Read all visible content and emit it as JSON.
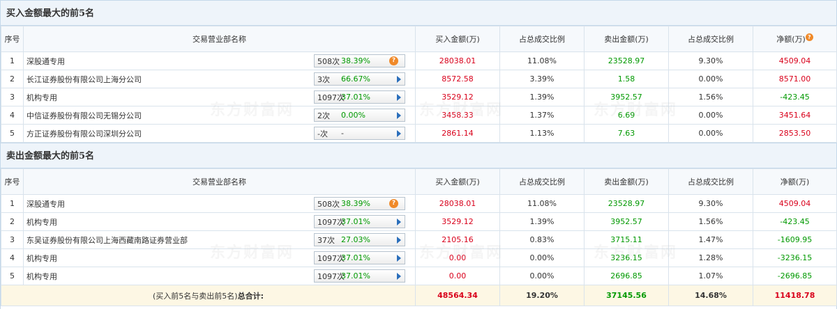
{
  "buy_section": {
    "title": "买入金额最大的前5名",
    "headers": [
      "序号",
      "交易营业部名称",
      "买入金额(万)",
      "占总成交比例",
      "卖出金额(万)",
      "占总成交比例",
      "净额(万)"
    ],
    "rows": [
      {
        "no": "1",
        "name": "深股通专用",
        "cnt": "508次",
        "pct": "38.39%",
        "icon": "question-icon",
        "buy": "28038.01",
        "buy_ratio": "11.08%",
        "sell": "23528.97",
        "sell_ratio": "9.30%",
        "net": "4509.04"
      },
      {
        "no": "2",
        "name": "长江证券股份有限公司上海分公司",
        "cnt": "3次",
        "pct": "66.67%",
        "icon": "arrow-right-icon",
        "buy": "8572.58",
        "buy_ratio": "3.39%",
        "sell": "1.58",
        "sell_ratio": "0.00%",
        "net": "8571.00"
      },
      {
        "no": "3",
        "name": "机构专用",
        "cnt": "1097次",
        "pct": "37.01%",
        "icon": "arrow-right-icon",
        "buy": "3529.12",
        "buy_ratio": "1.39%",
        "sell": "3952.57",
        "sell_ratio": "1.56%",
        "net": "-423.45"
      },
      {
        "no": "4",
        "name": "中信证券股份有限公司无锡分公司",
        "cnt": "2次",
        "pct": "0.00%",
        "icon": "arrow-right-icon",
        "buy": "3458.33",
        "buy_ratio": "1.37%",
        "sell": "6.69",
        "sell_ratio": "0.00%",
        "net": "3451.64"
      },
      {
        "no": "5",
        "name": "方正证券股份有限公司深圳分公司",
        "cnt": "-次",
        "pct": "-",
        "icon": "arrow-right-icon",
        "buy": "2861.14",
        "buy_ratio": "1.13%",
        "sell": "7.63",
        "sell_ratio": "0.00%",
        "net": "2853.50"
      }
    ]
  },
  "sell_section": {
    "title": "卖出金额最大的前5名",
    "headers": [
      "序号",
      "交易营业部名称",
      "买入金额(万)",
      "占总成交比例",
      "卖出金额(万)",
      "占总成交比例",
      "净额(万)"
    ],
    "rows": [
      {
        "no": "1",
        "name": "深股通专用",
        "cnt": "508次",
        "pct": "38.39%",
        "icon": "question-icon",
        "buy": "28038.01",
        "buy_ratio": "11.08%",
        "sell": "23528.97",
        "sell_ratio": "9.30%",
        "net": "4509.04"
      },
      {
        "no": "2",
        "name": "机构专用",
        "cnt": "1097次",
        "pct": "37.01%",
        "icon": "arrow-right-icon",
        "buy": "3529.12",
        "buy_ratio": "1.39%",
        "sell": "3952.57",
        "sell_ratio": "1.56%",
        "net": "-423.45"
      },
      {
        "no": "3",
        "name": "东吴证券股份有限公司上海西藏南路证券营业部",
        "cnt": "37次",
        "pct": "27.03%",
        "icon": "arrow-right-icon",
        "buy": "2105.16",
        "buy_ratio": "0.83%",
        "sell": "3715.11",
        "sell_ratio": "1.47%",
        "net": "-1609.95"
      },
      {
        "no": "4",
        "name": "机构专用",
        "cnt": "1097次",
        "pct": "37.01%",
        "icon": "arrow-right-icon",
        "buy": "0.00",
        "buy_ratio": "0.00%",
        "sell": "3236.15",
        "sell_ratio": "1.28%",
        "net": "-3236.15"
      },
      {
        "no": "5",
        "name": "机构专用",
        "cnt": "1097次",
        "pct": "37.01%",
        "icon": "arrow-right-icon",
        "buy": "0.00",
        "buy_ratio": "0.00%",
        "sell": "2696.85",
        "sell_ratio": "1.07%",
        "net": "-2696.85"
      }
    ],
    "total": {
      "label_prefix": "(买入前5名与卖出前5名)",
      "label_bold": "总合计:",
      "buy": "48564.34",
      "buy_ratio": "19.20%",
      "sell": "37145.56",
      "sell_ratio": "14.68%",
      "net": "11418.78"
    }
  },
  "colors": {
    "positive": "#d9001b",
    "negative": "#009900",
    "header_bg": "#eef4fa",
    "total_bg": "#fdf7e4"
  },
  "watermark": "东方财富网"
}
